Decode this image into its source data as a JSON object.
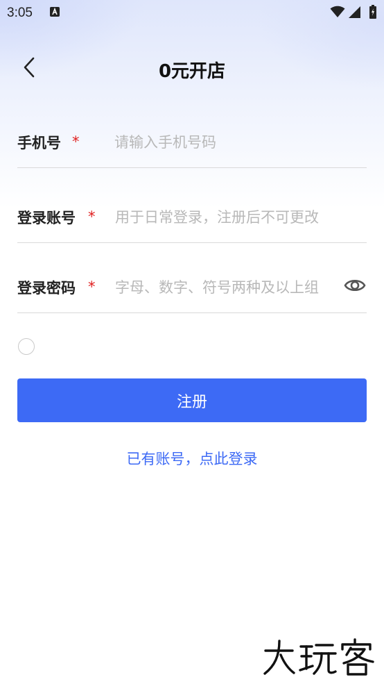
{
  "status_bar": {
    "time": "3:05"
  },
  "header": {
    "title": "0元开店",
    "back_icon": "chevron-left-icon"
  },
  "form": {
    "phone": {
      "label": "手机号",
      "required_mark": "*",
      "placeholder": "请输入手机号码",
      "value": ""
    },
    "account": {
      "label": "登录账号",
      "required_mark": "*",
      "placeholder": "用于日常登录，注册后不可更改",
      "value": ""
    },
    "password": {
      "label": "登录密码",
      "required_mark": "*",
      "placeholder": "字母、数字、符号两种及以上组",
      "value": "",
      "toggle_icon": "eye-icon"
    },
    "agreement_checked": false
  },
  "actions": {
    "register_label": "注册",
    "login_link": "已有账号，点此登录"
  },
  "watermark": {
    "text": "大玩客"
  },
  "colors": {
    "accent": "#3d6af5",
    "required": "#e02020",
    "placeholder": "#b8b8b8",
    "divider": "#d9d9d9"
  }
}
